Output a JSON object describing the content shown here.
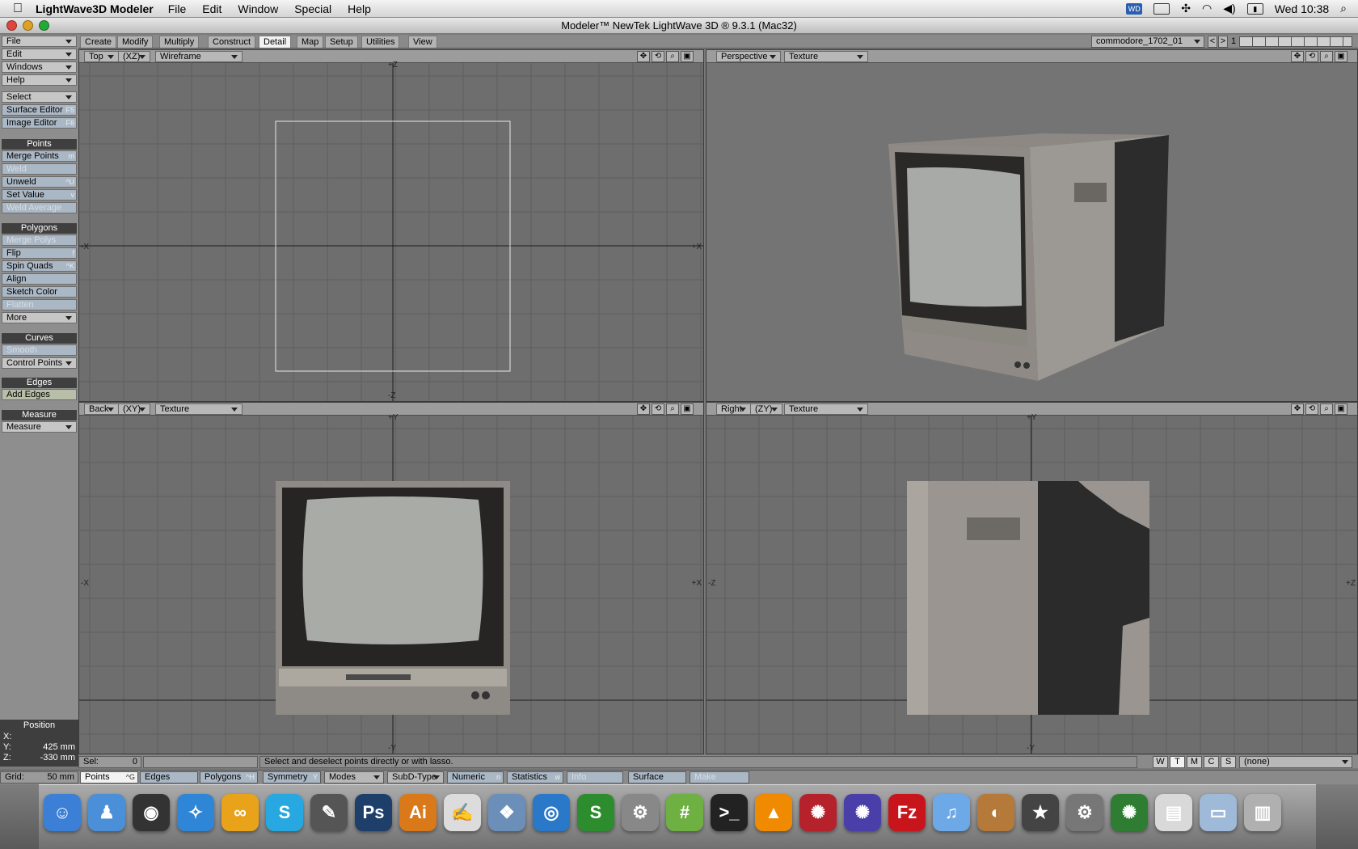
{
  "menubar": {
    "app": "LightWave3D Modeler",
    "items": [
      "File",
      "Edit",
      "Window",
      "Special",
      "Help"
    ],
    "clock": "Wed 10:38"
  },
  "window": {
    "title": "Modeler™ NewTek LightWave 3D ® 9.3.1 (Mac32)"
  },
  "sidebar": {
    "top": [
      {
        "label": "File"
      },
      {
        "label": "Edit"
      },
      {
        "label": "Windows"
      },
      {
        "label": "Help"
      }
    ],
    "tools": [
      {
        "label": "Select"
      },
      {
        "label": "Surface Editor",
        "key": "F5"
      },
      {
        "label": "Image Editor",
        "key": "F6"
      }
    ],
    "points_header": "Points",
    "points": [
      {
        "label": "Merge Points",
        "key": "m"
      },
      {
        "label": "Weld"
      },
      {
        "label": "Unweld",
        "key": "^U"
      },
      {
        "label": "Set Value",
        "key": "v"
      },
      {
        "label": "Weld Average"
      }
    ],
    "polygons_header": "Polygons",
    "polygons": [
      {
        "label": "Merge Polys"
      },
      {
        "label": "Flip",
        "key": "f"
      },
      {
        "label": "Spin Quads",
        "key": "^K"
      },
      {
        "label": "Align"
      },
      {
        "label": "Sketch Color"
      },
      {
        "label": "Flatten"
      },
      {
        "label": "More"
      }
    ],
    "curves_header": "Curves",
    "curves": [
      {
        "label": "Smooth"
      },
      {
        "label": "Control Points"
      }
    ],
    "edges_header": "Edges",
    "edges": [
      {
        "label": "Add Edges"
      }
    ],
    "measure_header": "Measure",
    "measure": [
      {
        "label": "Measure"
      }
    ]
  },
  "position": {
    "title": "Position",
    "x_label": "X:",
    "x": "",
    "y_label": "Y:",
    "y": "425 mm",
    "z_label": "Z:",
    "z": "-330 mm"
  },
  "tabs": [
    "Create",
    "Modify",
    "Multiply",
    "Construct",
    "Detail",
    "Map",
    "Setup",
    "Utilities",
    "View"
  ],
  "active_tab": "Detail",
  "layer": {
    "name": "commodore_1702_01",
    "number": "1"
  },
  "viewports": {
    "top": {
      "view": "Top",
      "axes": "(XZ)",
      "mode": "Wireframe",
      "lbl_top": "+Z",
      "lbl_bottom": "-Z",
      "lbl_left": "-X",
      "lbl_right": "+X"
    },
    "persp": {
      "view": "Perspective",
      "mode": "Texture"
    },
    "back": {
      "view": "Back",
      "axes": "(XY)",
      "mode": "Texture",
      "lbl_top": "+Y",
      "lbl_bottom": "-Y",
      "lbl_left": "-X",
      "lbl_right": "+X"
    },
    "right": {
      "view": "Right",
      "axes": "(ZY)",
      "mode": "Texture",
      "lbl_top": "+Y",
      "lbl_bottom": "-Y",
      "lbl_left": "-Z",
      "lbl_right": "+Z"
    }
  },
  "status": {
    "sel_label": "Sel:",
    "sel_value": "0",
    "message": "Select and deselect points directly or with lasso.",
    "wtmcs": [
      "W",
      "T",
      "M",
      "C",
      "S"
    ],
    "surface_select": "(none)"
  },
  "bottom": {
    "grid_label": "Grid:",
    "grid_value": "50 mm",
    "points": "Points",
    "points_key": "^G",
    "edges": "Edges",
    "polygons": "Polygons",
    "polygons_key": "^H",
    "symmetry": "Symmetry",
    "symmetry_key": "Y",
    "modes": "Modes",
    "subd": "SubD-Type",
    "numeric": "Numeric",
    "numeric_key": "n",
    "statistics": "Statistics",
    "statistics_key": "w",
    "info": "Info",
    "surface": "Surface",
    "make": "Make"
  },
  "dock": [
    {
      "name": "finder",
      "glyph": "☺",
      "color": "#3b7fd6"
    },
    {
      "name": "ichat",
      "glyph": "♟",
      "color": "#4a8fd8"
    },
    {
      "name": "dashboard",
      "glyph": "◉",
      "color": "#333"
    },
    {
      "name": "safari",
      "glyph": "✧",
      "color": "#2f86d6"
    },
    {
      "name": "adium",
      "glyph": "∞",
      "color": "#e9a31b"
    },
    {
      "name": "skype",
      "glyph": "S",
      "color": "#27a8e0"
    },
    {
      "name": "stuffit",
      "glyph": "✎",
      "color": "#555"
    },
    {
      "name": "photoshop",
      "glyph": "Ps",
      "color": "#1d3f6a"
    },
    {
      "name": "illustrator",
      "glyph": "Ai",
      "color": "#d9791a"
    },
    {
      "name": "textedit",
      "glyph": "✍",
      "color": "#dcdcdc"
    },
    {
      "name": "preview",
      "glyph": "❖",
      "color": "#6b8fb8"
    },
    {
      "name": "blender",
      "glyph": "◎",
      "color": "#2a78c8"
    },
    {
      "name": "s-app",
      "glyph": "S",
      "color": "#2d8c2d"
    },
    {
      "name": "scanner",
      "glyph": "⚙",
      "color": "#888"
    },
    {
      "name": "messages",
      "glyph": "#",
      "color": "#6fb043"
    },
    {
      "name": "terminal",
      "glyph": ">_",
      "color": "#222"
    },
    {
      "name": "vlc",
      "glyph": "▲",
      "color": "#f08a00"
    },
    {
      "name": "lightwave-layout",
      "glyph": "✺",
      "color": "#b5222b"
    },
    {
      "name": "lightwave-hub",
      "glyph": "✺",
      "color": "#4a3fa8"
    },
    {
      "name": "filezilla",
      "glyph": "Fz",
      "color": "#c8151b"
    },
    {
      "name": "itunes",
      "glyph": "♫",
      "color": "#6da9e6"
    },
    {
      "name": "iphoto",
      "glyph": "◐",
      "color": "#b57a3a"
    },
    {
      "name": "imovie",
      "glyph": "★",
      "color": "#444"
    },
    {
      "name": "system-preferences",
      "glyph": "⚙",
      "color": "#777"
    },
    {
      "name": "lightwave-modeler",
      "glyph": "✺",
      "color": "#2f7d32"
    },
    {
      "name": "documents",
      "glyph": "▤",
      "color": "#d9d9d9"
    },
    {
      "name": "downloads",
      "glyph": "▭",
      "color": "#9fbad8"
    },
    {
      "name": "trash",
      "glyph": "▥",
      "color": "#b0b0b0"
    }
  ]
}
